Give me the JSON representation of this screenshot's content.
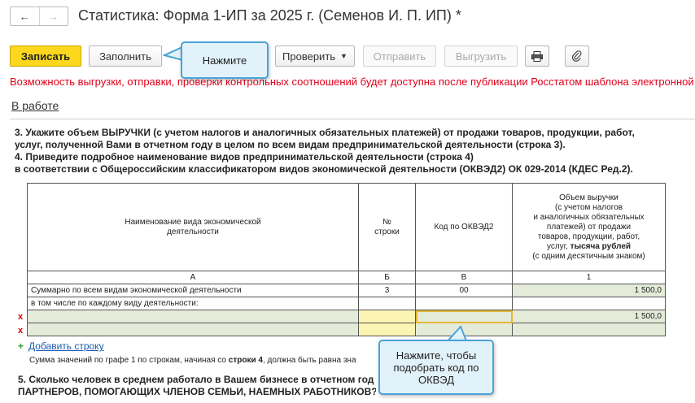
{
  "window": {
    "title": "Статистика: Форма 1-ИП за 2025 г. (Семенов И. П. ИП) *",
    "nav": {
      "back_icon": "arrow-left",
      "forward_icon": "arrow-right"
    }
  },
  "toolbar": {
    "save_label": "Записать",
    "fill_label": "Заполнить",
    "check_label": "Проверить",
    "send_label": "Отправить",
    "upload_label": "Выгрузить",
    "print_icon": "printer-icon",
    "attach_icon": "paperclip-icon"
  },
  "warning": "Возможность выгрузки, отправки, проверки контрольных соотношений будет доступна после публикации Росстатом шаблона электронной",
  "status": "В работе",
  "form": {
    "q3_line1": "3. Укажите объем ВЫРУЧКИ (с учетом налогов и аналогичных обязательных платежей) от продажи товаров, продукции, работ,",
    "q3_line2": "услуг, полученной Вами в отчетном году в целом по всем видам предпринимательской деятельности (строка 3).",
    "q4_line1": "4. Приведите подробное наименование видов предпринимательской деятельности (строка 4)",
    "q4_line2": "в соответствии с Общероссийским классификатором видов экономической деятельности (ОКВЭД2) ОК 029-2014 (КДЕС Ред.2).",
    "table": {
      "headers": {
        "name_line1": "Наименование вида экономической",
        "name_line2": "деятельности",
        "row_no_line1": "№",
        "row_no_line2": "строки",
        "okved": "Код по ОКВЭД2",
        "rev_line1": "Объем выручки",
        "rev_line2": "(с учетом налогов",
        "rev_line3": "и аналогичных обязательных",
        "rev_line4": "платежей) от продажи",
        "rev_line5": "товаров, продукции, работ,",
        "rev_line6a": "услуг, ",
        "rev_line6b": "тысяча рублей",
        "rev_line7": "(с одним десятичным знаком)"
      },
      "col_letters": [
        "А",
        "Б",
        "В",
        "1"
      ],
      "total_row": {
        "name": "Суммарно по всем видам экономической деятельности",
        "row_no": "3",
        "okved": "00",
        "value": "1 500,0"
      },
      "sub_row": {
        "name": "в том числе по каждому виду деятельности:"
      },
      "data_rows": [
        {
          "mark": "x",
          "name": "",
          "row_no": "",
          "okved": "",
          "value": "1 500,0"
        },
        {
          "mark": "x",
          "name": "",
          "row_no": "",
          "okved": "",
          "value": ""
        }
      ]
    },
    "add_row": "Добавить строку",
    "note_prefix": "Сумма значений по графе 1 по строкам, начиная со ",
    "note_bold": "строки 4",
    "note_suffix": ", должна быть равна зна",
    "q5_line1": "5. Сколько человек в среднем  работало в Вашем бизнесе в отчетном год",
    "q5_line2": "ПАРТНЕРОВ, ПОМОГАЮЩИХ ЧЛЕНОВ СЕМЬИ, НАЕМНЫХ РАБОТНИКОВ?"
  },
  "callouts": {
    "top": "Нажмите",
    "bottom": "Нажмите, чтобы подобрать код по ОКВЭД"
  }
}
